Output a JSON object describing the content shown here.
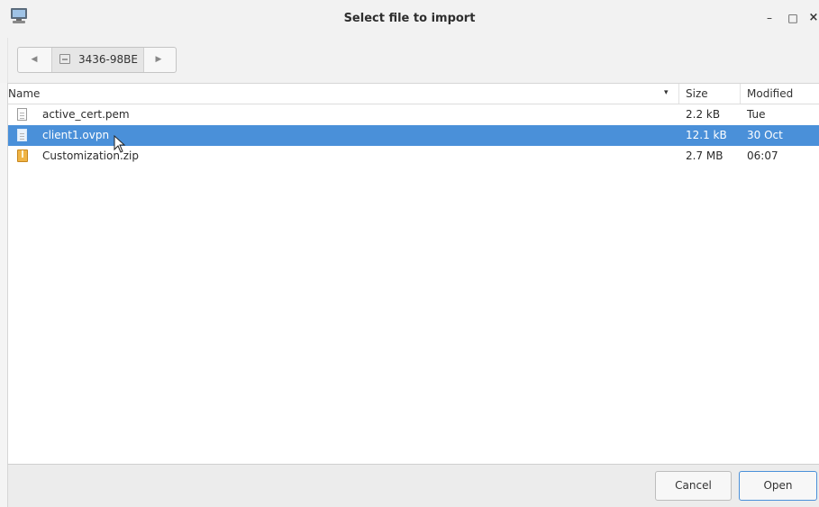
{
  "window": {
    "title": "Select file to import",
    "app_icon": "monitor-icon",
    "controls": {
      "minimize": "–",
      "maximize": "□",
      "close": "×"
    }
  },
  "pathbar": {
    "back_icon": "chevron-left-icon",
    "forward_icon": "chevron-right-icon",
    "location_icon": "drive-icon",
    "location_label": "3436-98BE"
  },
  "filelist": {
    "columns": {
      "name": "Name",
      "size": "Size",
      "modified": "Modified"
    },
    "sort_indicator": "▾",
    "rows": [
      {
        "icon": "document-icon",
        "name": "active_cert.pem",
        "size": "2.2 kB",
        "modified": "Tue",
        "selected": false
      },
      {
        "icon": "document-icon",
        "name": "client1.ovpn",
        "size": "12.1 kB",
        "modified": "30 Oct",
        "selected": true
      },
      {
        "icon": "archive-icon",
        "name": "Customization.zip",
        "size": "2.7 MB",
        "modified": "06:07",
        "selected": false
      }
    ]
  },
  "footer": {
    "cancel_label": "Cancel",
    "open_label": "Open"
  },
  "colors": {
    "selection": "#4a90d9",
    "background": "#f4f4f4"
  }
}
